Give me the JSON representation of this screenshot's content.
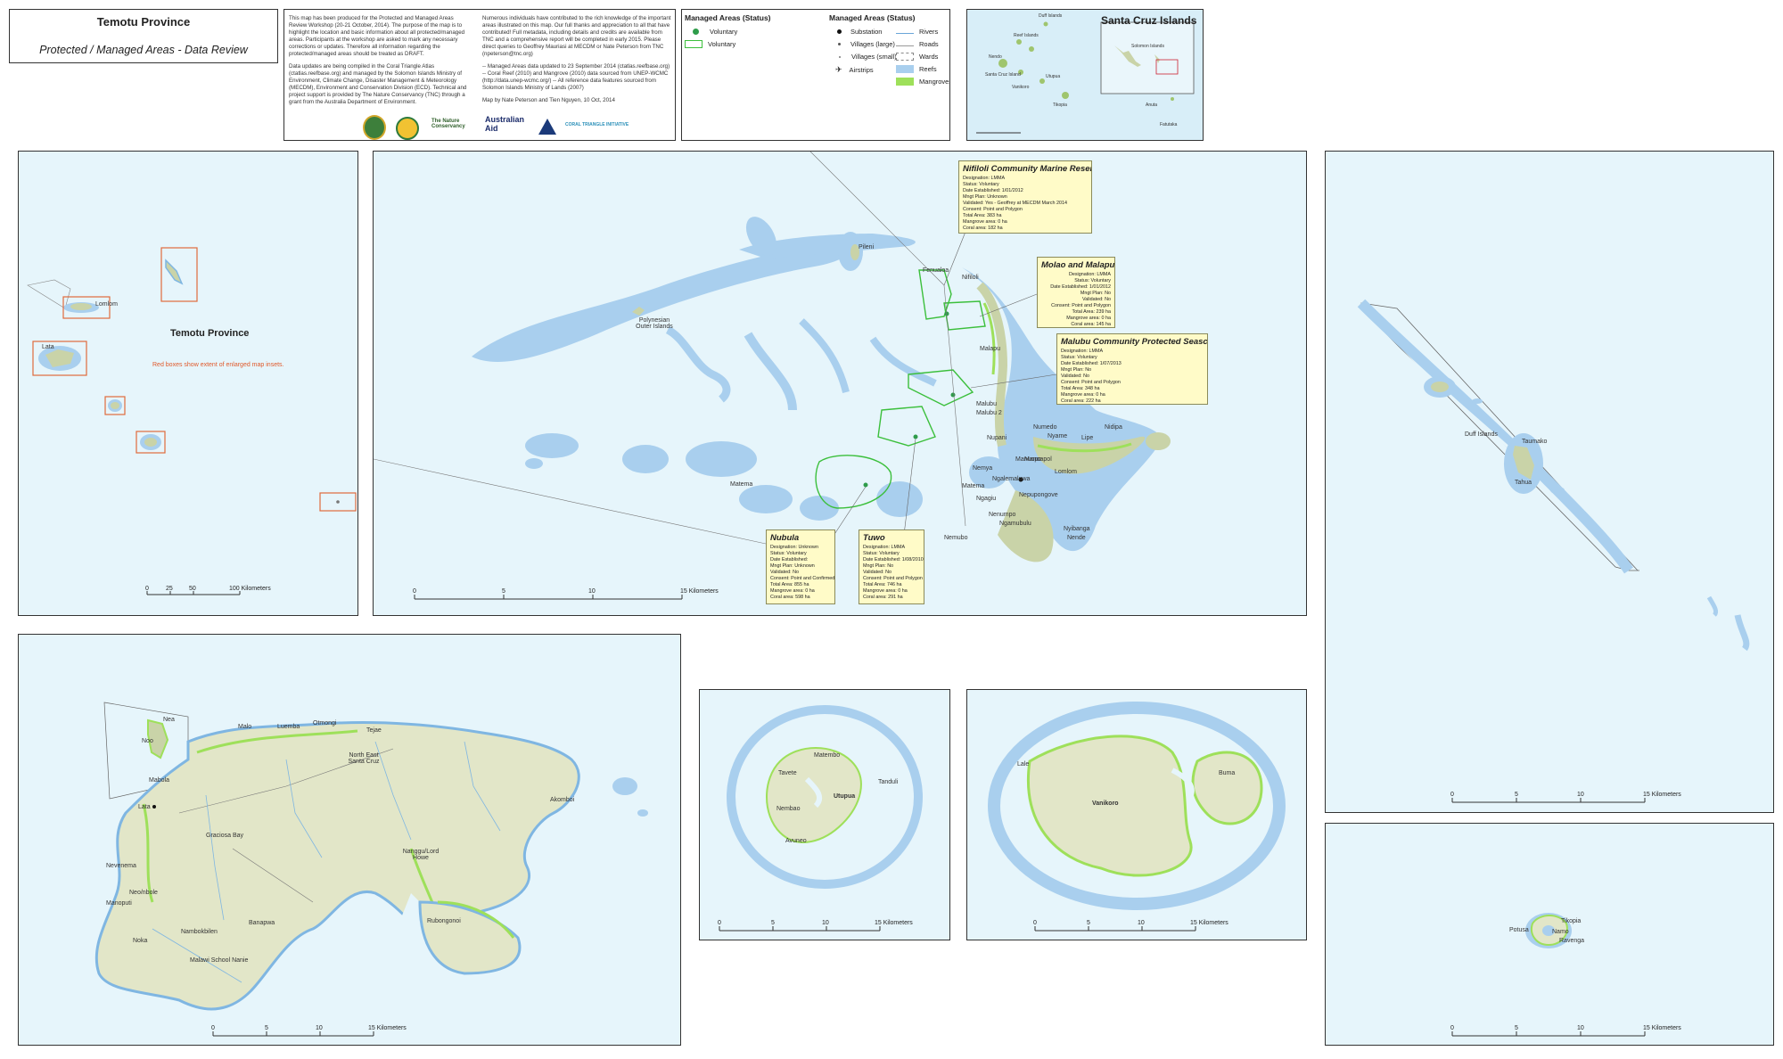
{
  "title_box": {
    "title": "Temotu Province",
    "subtitle": "Protected / Managed Areas - Data Review"
  },
  "notes": {
    "col1": [
      "This map has been produced for the Protected and Managed Areas Review Workshop (20-21 October, 2014). The purpose of the map is to highlight the location and basic information about all protected/managed areas. Participants at the workshop are asked to mark any necessary corrections or updates. Therefore all information regarding the protected/managed areas should be treated as DRAFT.",
      "Data updates are being compiled in the Coral Triangle Atlas (ctatlas.reefbase.org) and managed by the Solomon Islands Ministry of Environment, Climate Change, Disaster Management & Meteorology (MECDM), Environment and Conservation Division (ECD). Technical and project support is provided by The Nature Conservancy (TNC) through a grant from the Australia Department of Environment."
    ],
    "col2": [
      "Numerous individuals have contributed to the rich knowledge of the important areas illustrated on this map. Our full thanks and appreciation to all that have contributed! Full metadata, including details and credits are available from TNC and a comprehensive report will be completed in early 2015. Please direct queries to Geoffrey Mauriasi at MECDM or Nate Peterson from TNC (npeterson@tnc.org)",
      "-- Managed Areas data updated to 23 September 2014 (ctatlas.reefbase.org) -- Coral Reef (2010) and Mangrove (2010) data sourced from UNEP-WCMC (http://data.unep-wcmc.org/) -- All reference data features sourced from Solomon Islands Ministry of Lands (2007)",
      "Map by Nate Peterson and Tien Nguyen, 10 Oct, 2014"
    ],
    "logos": [
      "The Nature Conservancy",
      "Australian Aid",
      "CORAL TRIANGLE INITIATIVE"
    ]
  },
  "legend": {
    "left_title": "Managed Areas (Status)",
    "left_items": [
      "Voluntary",
      "Voluntary"
    ],
    "right_title": "Managed Areas (Status)",
    "right_items": [
      "Substation",
      "Villages (large)",
      "Villages (small)",
      "Airstrips"
    ],
    "far_items": [
      "Rivers",
      "Roads",
      "Wards",
      "Reefs",
      "Mangroves"
    ],
    "colors": {
      "voluntary": "#2e9c4a",
      "reefs": "#a9cfee",
      "mangroves": "#9ee05a",
      "land": "#e2e6c8",
      "sea": "#e6f5fb"
    }
  },
  "inset": {
    "title": "Santa Cruz Islands",
    "subtitle": "Solomon Islands",
    "labels": [
      "Duff Islands",
      "Reef Islands",
      "Santa Cruz Island",
      "Vanikoro",
      "Utupua",
      "Tikopia",
      "Anuta",
      "Fatutaka",
      "Nendo"
    ]
  },
  "overview": {
    "title": "Temotu Province",
    "note": "Red boxes show extent of enlarged map insets.",
    "labels": [
      "Lomlom",
      "Lata"
    ],
    "scale": [
      "0",
      "25",
      "50",
      "100 Kilometers"
    ]
  },
  "reef_map": {
    "labels": [
      "Polynesian Outer Islands",
      "Fenualoa",
      "Nifiloli",
      "Pileni",
      "Matema",
      "Malapu",
      "Malubu",
      "Malubu 2",
      "Numedo",
      "Nyame",
      "Manuopo",
      "Ngalemaluwa",
      "Nemya",
      "Lomlom",
      "Nupani",
      "Lipe",
      "Nidipa",
      "Manoapol",
      "Ngagiu",
      "Nepupongove",
      "Nenumpo",
      "Ngamubulu",
      "Nyibanga",
      "Nende",
      "Nemubo",
      "Matema"
    ],
    "boxes": [
      {
        "title": "Nifiloli Community Marine Reserve",
        "rows": [
          "Designation: LMMA",
          "Status: Voluntary",
          "Date Established: 1/01/2012",
          "Mngt Plan: Unknown",
          "Validated: Yes - Geoffrey at MECDM March 2014",
          "Consent: Point and Polygon",
          "Total Area: 383 ha",
          "Mangrove area: 0 ha",
          "Coral area: 182 ha"
        ]
      },
      {
        "title": "Molao and Malapu",
        "rows": [
          "Designation: LMMA",
          "Status: Voluntary",
          "Date Established: 1/01/2012",
          "Mngt Plan: No",
          "Validated: No",
          "Consent: Point and Polygon",
          "Total Area: 239 ha",
          "Mangrove area: 0 ha",
          "Coral area: 145 ha"
        ]
      },
      {
        "title": "Malubu Community Protected Seascape",
        "rows": [
          "Designation: LMMA",
          "Status: Voluntary",
          "Date Established: 1/07/2013",
          "Mngt Plan: No",
          "Validated: No",
          "Consent: Point and Polygon",
          "Total Area: 348 ha",
          "Mangrove area: 0 ha",
          "Coral area: 222 ha"
        ]
      },
      {
        "title": "Nubula",
        "rows": [
          "Designation: Unknown",
          "Status: Voluntary",
          "Date Established:",
          "Mngt Plan: Unknown",
          "Validated: No",
          "Consent: Point and Confirmed",
          "Total Area: 855 ha",
          "Mangrove area: 0 ha",
          "Coral area: 598 ha"
        ]
      },
      {
        "title": "Tuwo",
        "rows": [
          "Designation: LMMA",
          "Status: Voluntary",
          "Date Established: 1/08/2010",
          "Mngt Plan: No",
          "Validated: No",
          "Consent: Point and Polygon",
          "Total Area: 746 ha",
          "Mangrove area: 0 ha",
          "Coral area: 291 ha"
        ]
      }
    ],
    "scale": [
      "0",
      "5",
      "10",
      "15 Kilometers"
    ]
  },
  "duff_map": {
    "labels": [
      "Duff Islands",
      "Taumako",
      "Tahua"
    ],
    "scale": [
      "0",
      "5",
      "10",
      "15 Kilometers"
    ]
  },
  "santacruz_map": {
    "labels": [
      "Nea",
      "Noo",
      "Malo",
      "Luemba",
      "Otmongi",
      "Tejae",
      "Lata",
      "Mabola",
      "Graciosa Bay",
      "North East Santa Cruz",
      "Nanggu/Lord Howe",
      "Nevenema",
      "Neo/nbole",
      "Manoputi",
      "Banapwa",
      "Nambokbilen",
      "Noka",
      "Malawi School Nanie",
      "Rubongonoi",
      "Akomboi"
    ],
    "scale": [
      "0",
      "5",
      "10",
      "15 Kilometers"
    ]
  },
  "utupua_map": {
    "labels": [
      "Matembo",
      "Utupua",
      "Nembao",
      "Avuneo",
      "Tanduli",
      "Tavete"
    ],
    "scale": [
      "0",
      "5",
      "10",
      "15 Kilometers"
    ]
  },
  "vanikoro_map": {
    "labels": [
      "Vanikoro",
      "Buma",
      "Lale"
    ],
    "scale": [
      "0",
      "5",
      "10",
      "15 Kilometers"
    ]
  },
  "tikopia_map": {
    "labels": [
      "Tikopia",
      "Ravenga",
      "Potusa",
      "Namo"
    ],
    "scale": [
      "0",
      "5",
      "10",
      "15 Kilometers"
    ]
  }
}
